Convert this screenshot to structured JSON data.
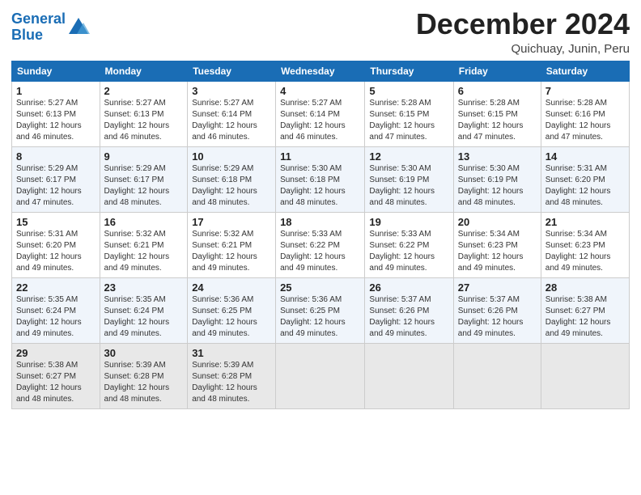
{
  "logo": {
    "line1": "General",
    "line2": "Blue"
  },
  "title": "December 2024",
  "location": "Quichuay, Junin, Peru",
  "days_header": [
    "Sunday",
    "Monday",
    "Tuesday",
    "Wednesday",
    "Thursday",
    "Friday",
    "Saturday"
  ],
  "weeks": [
    [
      {
        "num": "1",
        "rise": "5:27 AM",
        "set": "6:13 PM",
        "daylight": "12 hours and 46 minutes."
      },
      {
        "num": "2",
        "rise": "5:27 AM",
        "set": "6:13 PM",
        "daylight": "12 hours and 46 minutes."
      },
      {
        "num": "3",
        "rise": "5:27 AM",
        "set": "6:14 PM",
        "daylight": "12 hours and 46 minutes."
      },
      {
        "num": "4",
        "rise": "5:27 AM",
        "set": "6:14 PM",
        "daylight": "12 hours and 46 minutes."
      },
      {
        "num": "5",
        "rise": "5:28 AM",
        "set": "6:15 PM",
        "daylight": "12 hours and 47 minutes."
      },
      {
        "num": "6",
        "rise": "5:28 AM",
        "set": "6:15 PM",
        "daylight": "12 hours and 47 minutes."
      },
      {
        "num": "7",
        "rise": "5:28 AM",
        "set": "6:16 PM",
        "daylight": "12 hours and 47 minutes."
      }
    ],
    [
      {
        "num": "8",
        "rise": "5:29 AM",
        "set": "6:17 PM",
        "daylight": "12 hours and 47 minutes."
      },
      {
        "num": "9",
        "rise": "5:29 AM",
        "set": "6:17 PM",
        "daylight": "12 hours and 48 minutes."
      },
      {
        "num": "10",
        "rise": "5:29 AM",
        "set": "6:18 PM",
        "daylight": "12 hours and 48 minutes."
      },
      {
        "num": "11",
        "rise": "5:30 AM",
        "set": "6:18 PM",
        "daylight": "12 hours and 48 minutes."
      },
      {
        "num": "12",
        "rise": "5:30 AM",
        "set": "6:19 PM",
        "daylight": "12 hours and 48 minutes."
      },
      {
        "num": "13",
        "rise": "5:30 AM",
        "set": "6:19 PM",
        "daylight": "12 hours and 48 minutes."
      },
      {
        "num": "14",
        "rise": "5:31 AM",
        "set": "6:20 PM",
        "daylight": "12 hours and 48 minutes."
      }
    ],
    [
      {
        "num": "15",
        "rise": "5:31 AM",
        "set": "6:20 PM",
        "daylight": "12 hours and 49 minutes."
      },
      {
        "num": "16",
        "rise": "5:32 AM",
        "set": "6:21 PM",
        "daylight": "12 hours and 49 minutes."
      },
      {
        "num": "17",
        "rise": "5:32 AM",
        "set": "6:21 PM",
        "daylight": "12 hours and 49 minutes."
      },
      {
        "num": "18",
        "rise": "5:33 AM",
        "set": "6:22 PM",
        "daylight": "12 hours and 49 minutes."
      },
      {
        "num": "19",
        "rise": "5:33 AM",
        "set": "6:22 PM",
        "daylight": "12 hours and 49 minutes."
      },
      {
        "num": "20",
        "rise": "5:34 AM",
        "set": "6:23 PM",
        "daylight": "12 hours and 49 minutes."
      },
      {
        "num": "21",
        "rise": "5:34 AM",
        "set": "6:23 PM",
        "daylight": "12 hours and 49 minutes."
      }
    ],
    [
      {
        "num": "22",
        "rise": "5:35 AM",
        "set": "6:24 PM",
        "daylight": "12 hours and 49 minutes."
      },
      {
        "num": "23",
        "rise": "5:35 AM",
        "set": "6:24 PM",
        "daylight": "12 hours and 49 minutes."
      },
      {
        "num": "24",
        "rise": "5:36 AM",
        "set": "6:25 PM",
        "daylight": "12 hours and 49 minutes."
      },
      {
        "num": "25",
        "rise": "5:36 AM",
        "set": "6:25 PM",
        "daylight": "12 hours and 49 minutes."
      },
      {
        "num": "26",
        "rise": "5:37 AM",
        "set": "6:26 PM",
        "daylight": "12 hours and 49 minutes."
      },
      {
        "num": "27",
        "rise": "5:37 AM",
        "set": "6:26 PM",
        "daylight": "12 hours and 49 minutes."
      },
      {
        "num": "28",
        "rise": "5:38 AM",
        "set": "6:27 PM",
        "daylight": "12 hours and 49 minutes."
      }
    ],
    [
      {
        "num": "29",
        "rise": "5:38 AM",
        "set": "6:27 PM",
        "daylight": "12 hours and 48 minutes."
      },
      {
        "num": "30",
        "rise": "5:39 AM",
        "set": "6:28 PM",
        "daylight": "12 hours and 48 minutes."
      },
      {
        "num": "31",
        "rise": "5:39 AM",
        "set": "6:28 PM",
        "daylight": "12 hours and 48 minutes."
      },
      null,
      null,
      null,
      null
    ]
  ]
}
